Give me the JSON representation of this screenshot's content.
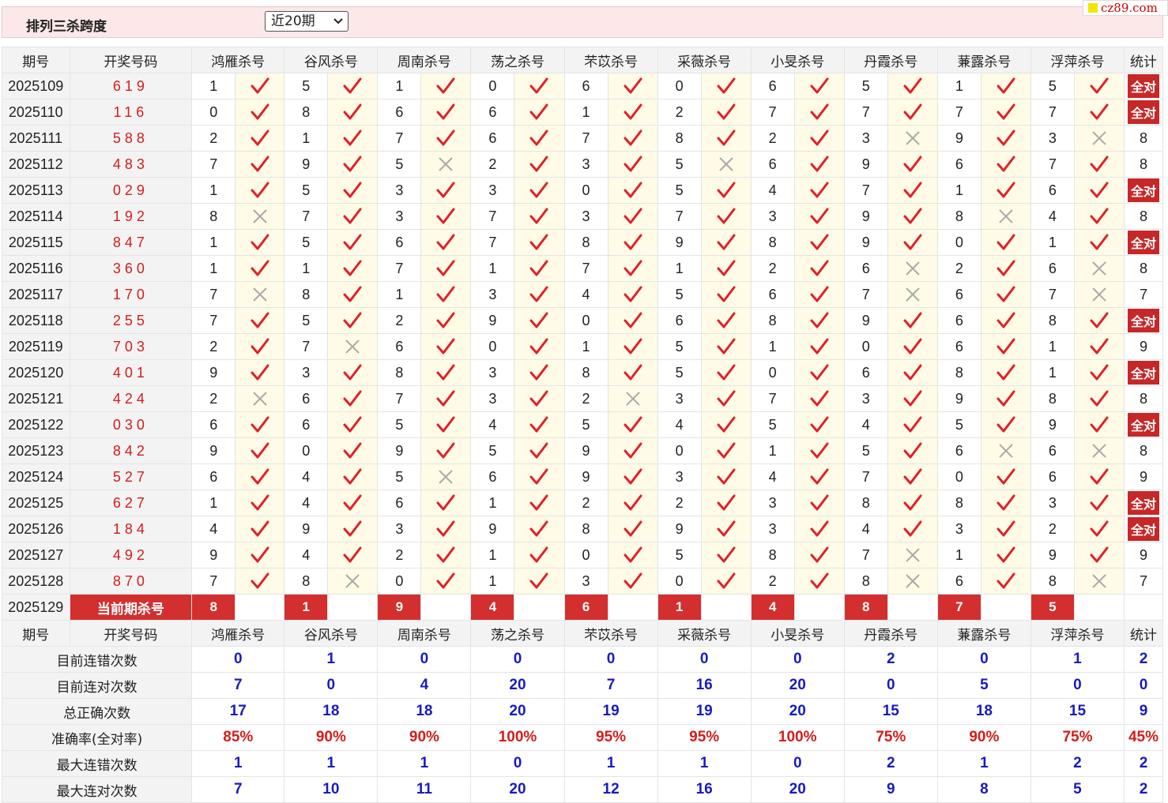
{
  "page": {
    "title": "排列三杀跨度",
    "period_select": "近20期",
    "site_badge": "cz89.com"
  },
  "colors": {
    "accent_red": "#d32f2f",
    "stat_blue": "#1a1ac0",
    "header_pink": "#fce8e8"
  },
  "headers": {
    "period": "期号",
    "draw": "开奖号码",
    "experts": [
      "鸿雁杀号",
      "谷风杀号",
      "周南杀号",
      "荡之杀号",
      "芣苡杀号",
      "采薇杀号",
      "小旻杀号",
      "丹霞杀号",
      "蒹露杀号",
      "浮萍杀号"
    ],
    "stat": "统计"
  },
  "rows": [
    {
      "period": "2025109",
      "draw": "619",
      "kills": [
        "1",
        "5",
        "1",
        "0",
        "6",
        "0",
        "6",
        "5",
        "1",
        "5"
      ],
      "ok": [
        1,
        1,
        1,
        1,
        1,
        1,
        1,
        1,
        1,
        1
      ],
      "stat": "全对"
    },
    {
      "period": "2025110",
      "draw": "116",
      "kills": [
        "0",
        "8",
        "6",
        "6",
        "1",
        "2",
        "7",
        "7",
        "7",
        "7"
      ],
      "ok": [
        1,
        1,
        1,
        1,
        1,
        1,
        1,
        1,
        1,
        1
      ],
      "stat": "全对"
    },
    {
      "period": "2025111",
      "draw": "588",
      "kills": [
        "2",
        "1",
        "7",
        "6",
        "7",
        "8",
        "2",
        "3",
        "9",
        "3"
      ],
      "ok": [
        1,
        1,
        1,
        1,
        1,
        1,
        1,
        0,
        1,
        0
      ],
      "stat": "8"
    },
    {
      "period": "2025112",
      "draw": "483",
      "kills": [
        "7",
        "9",
        "5",
        "2",
        "3",
        "5",
        "6",
        "9",
        "6",
        "7"
      ],
      "ok": [
        1,
        1,
        0,
        1,
        1,
        0,
        1,
        1,
        1,
        1
      ],
      "stat": "8"
    },
    {
      "period": "2025113",
      "draw": "029",
      "kills": [
        "1",
        "5",
        "3",
        "3",
        "0",
        "5",
        "4",
        "7",
        "1",
        "6"
      ],
      "ok": [
        1,
        1,
        1,
        1,
        1,
        1,
        1,
        1,
        1,
        1
      ],
      "stat": "全对"
    },
    {
      "period": "2025114",
      "draw": "192",
      "kills": [
        "8",
        "7",
        "3",
        "7",
        "3",
        "7",
        "3",
        "9",
        "8",
        "4"
      ],
      "ok": [
        0,
        1,
        1,
        1,
        1,
        1,
        1,
        1,
        0,
        1
      ],
      "stat": "8"
    },
    {
      "period": "2025115",
      "draw": "847",
      "kills": [
        "1",
        "5",
        "6",
        "7",
        "8",
        "9",
        "8",
        "9",
        "0",
        "1"
      ],
      "ok": [
        1,
        1,
        1,
        1,
        1,
        1,
        1,
        1,
        1,
        1
      ],
      "stat": "全对"
    },
    {
      "period": "2025116",
      "draw": "360",
      "kills": [
        "1",
        "1",
        "7",
        "1",
        "7",
        "1",
        "2",
        "6",
        "2",
        "6"
      ],
      "ok": [
        1,
        1,
        1,
        1,
        1,
        1,
        1,
        0,
        1,
        0
      ],
      "stat": "8"
    },
    {
      "period": "2025117",
      "draw": "170",
      "kills": [
        "7",
        "8",
        "1",
        "3",
        "4",
        "5",
        "6",
        "7",
        "6",
        "7"
      ],
      "ok": [
        0,
        1,
        1,
        1,
        1,
        1,
        1,
        0,
        1,
        0
      ],
      "stat": "7"
    },
    {
      "period": "2025118",
      "draw": "255",
      "kills": [
        "7",
        "5",
        "2",
        "9",
        "0",
        "6",
        "8",
        "9",
        "6",
        "8"
      ],
      "ok": [
        1,
        1,
        1,
        1,
        1,
        1,
        1,
        1,
        1,
        1
      ],
      "stat": "全对"
    },
    {
      "period": "2025119",
      "draw": "703",
      "kills": [
        "2",
        "7",
        "6",
        "0",
        "1",
        "5",
        "1",
        "0",
        "6",
        "1"
      ],
      "ok": [
        1,
        0,
        1,
        1,
        1,
        1,
        1,
        1,
        1,
        1
      ],
      "stat": "9"
    },
    {
      "period": "2025120",
      "draw": "401",
      "kills": [
        "9",
        "3",
        "8",
        "3",
        "8",
        "5",
        "0",
        "6",
        "8",
        "1"
      ],
      "ok": [
        1,
        1,
        1,
        1,
        1,
        1,
        1,
        1,
        1,
        1
      ],
      "stat": "全对"
    },
    {
      "period": "2025121",
      "draw": "424",
      "kills": [
        "2",
        "6",
        "7",
        "3",
        "2",
        "3",
        "7",
        "3",
        "9",
        "8"
      ],
      "ok": [
        0,
        1,
        1,
        1,
        0,
        1,
        1,
        1,
        1,
        1
      ],
      "stat": "8"
    },
    {
      "period": "2025122",
      "draw": "030",
      "kills": [
        "6",
        "6",
        "5",
        "4",
        "5",
        "4",
        "5",
        "4",
        "5",
        "9"
      ],
      "ok": [
        1,
        1,
        1,
        1,
        1,
        1,
        1,
        1,
        1,
        1
      ],
      "stat": "全对"
    },
    {
      "period": "2025123",
      "draw": "842",
      "kills": [
        "9",
        "0",
        "9",
        "5",
        "9",
        "0",
        "1",
        "5",
        "6",
        "6"
      ],
      "ok": [
        1,
        1,
        1,
        1,
        1,
        1,
        1,
        1,
        0,
        0
      ],
      "stat": "8"
    },
    {
      "period": "2025124",
      "draw": "527",
      "kills": [
        "6",
        "4",
        "5",
        "6",
        "9",
        "3",
        "4",
        "7",
        "0",
        "6"
      ],
      "ok": [
        1,
        1,
        0,
        1,
        1,
        1,
        1,
        1,
        1,
        1
      ],
      "stat": "9"
    },
    {
      "period": "2025125",
      "draw": "627",
      "kills": [
        "1",
        "4",
        "6",
        "1",
        "2",
        "2",
        "3",
        "8",
        "8",
        "3"
      ],
      "ok": [
        1,
        1,
        1,
        1,
        1,
        1,
        1,
        1,
        1,
        1
      ],
      "stat": "全对"
    },
    {
      "period": "2025126",
      "draw": "184",
      "kills": [
        "4",
        "9",
        "3",
        "9",
        "8",
        "9",
        "3",
        "4",
        "3",
        "2"
      ],
      "ok": [
        1,
        1,
        1,
        1,
        1,
        1,
        1,
        1,
        1,
        1
      ],
      "stat": "全对"
    },
    {
      "period": "2025127",
      "draw": "492",
      "kills": [
        "9",
        "4",
        "2",
        "1",
        "0",
        "5",
        "8",
        "7",
        "1",
        "9"
      ],
      "ok": [
        1,
        1,
        1,
        1,
        1,
        1,
        1,
        0,
        1,
        1
      ],
      "stat": "9"
    },
    {
      "period": "2025128",
      "draw": "870",
      "kills": [
        "7",
        "8",
        "0",
        "1",
        "3",
        "0",
        "2",
        "8",
        "6",
        "8"
      ],
      "ok": [
        1,
        0,
        1,
        1,
        1,
        1,
        1,
        0,
        1,
        0
      ],
      "stat": "7"
    }
  ],
  "current": {
    "period": "2025129",
    "label": "当前期杀号",
    "kills": [
      "8",
      "1",
      "9",
      "4",
      "6",
      "1",
      "4",
      "8",
      "7",
      "5"
    ]
  },
  "summary": [
    {
      "label": "目前连错次数",
      "values": [
        "0",
        "1",
        "0",
        "0",
        "0",
        "0",
        "0",
        "2",
        "0",
        "1"
      ],
      "total": "2",
      "red": false
    },
    {
      "label": "目前连对次数",
      "values": [
        "7",
        "0",
        "4",
        "20",
        "7",
        "16",
        "20",
        "0",
        "5",
        "0"
      ],
      "total": "0",
      "red": false
    },
    {
      "label": "总正确次数",
      "values": [
        "17",
        "18",
        "18",
        "20",
        "19",
        "19",
        "20",
        "15",
        "18",
        "15"
      ],
      "total": "9",
      "red": false
    },
    {
      "label": "准确率(全对率)",
      "values": [
        "85%",
        "90%",
        "90%",
        "100%",
        "95%",
        "95%",
        "100%",
        "75%",
        "90%",
        "75%"
      ],
      "total": "45%",
      "red": true
    },
    {
      "label": "最大连错次数",
      "values": [
        "1",
        "1",
        "1",
        "0",
        "1",
        "1",
        "0",
        "2",
        "1",
        "2"
      ],
      "total": "2",
      "red": false
    },
    {
      "label": "最大连对次数",
      "values": [
        "7",
        "10",
        "11",
        "20",
        "12",
        "16",
        "20",
        "9",
        "8",
        "5"
      ],
      "total": "2",
      "red": false
    }
  ]
}
